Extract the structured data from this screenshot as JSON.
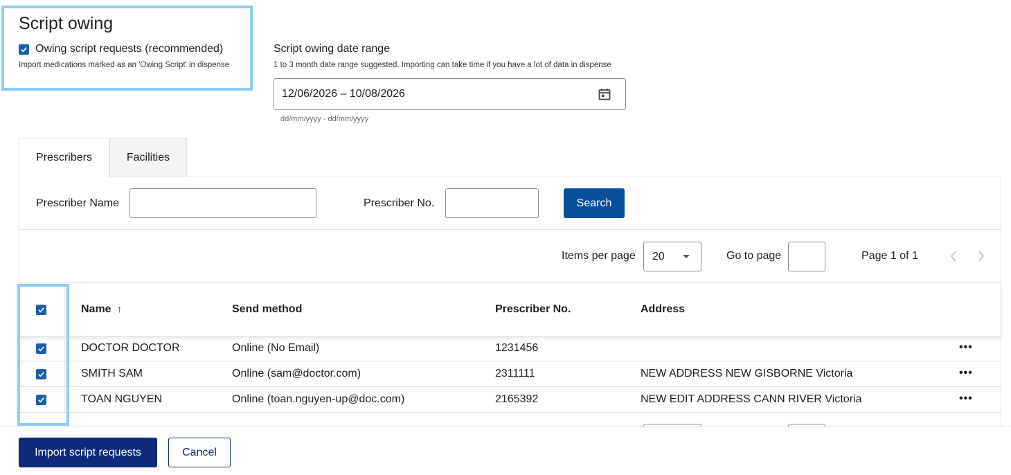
{
  "script_owing": {
    "title": "Script owing",
    "checkbox_label": "Owing script requests (recommended)",
    "checkbox_checked": true,
    "helper": "Import medications marked as an 'Owing Script' in dispense"
  },
  "date_range": {
    "label": "Script owing date range",
    "helper": "1 to 3 month date range suggested. Importing can take time if you have a lot of data in dispense",
    "value": "12/06/2026 – 10/08/2026",
    "format_hint": "dd/mm/yyyy - dd/mm/yyyy",
    "icon": "calendar-icon"
  },
  "tabs": [
    {
      "label": "Prescribers",
      "active": true
    },
    {
      "label": "Facilities",
      "active": false
    }
  ],
  "filters": {
    "name_label": "Prescriber Name",
    "name_value": "",
    "no_label": "Prescriber No.",
    "no_value": "",
    "search_label": "Search"
  },
  "pagination": {
    "items_per_page_label": "Items per page",
    "items_per_page_value": "20",
    "go_to_page_label": "Go to page",
    "go_to_page_value": "",
    "page_info": "Page 1 of 1"
  },
  "table": {
    "columns": {
      "name": "Name",
      "name_sort_icon": "↑",
      "send_method": "Send method",
      "prescriber_no": "Prescriber No.",
      "address": "Address"
    },
    "rows": [
      {
        "name": "DOCTOR DOCTOR",
        "send_method": "Online (No Email)",
        "prescriber_no": "1231456",
        "address": "",
        "checked": true
      },
      {
        "name": "SMITH SAM",
        "send_method": "Online (sam@doctor.com)",
        "prescriber_no": "2311111",
        "address": "NEW ADDRESS NEW GISBORNE Victoria",
        "checked": true
      },
      {
        "name": "TOAN NGUYEN",
        "send_method": "Online (toan.nguyen-up@doc.com)",
        "prescriber_no": "2165392",
        "address": "NEW EDIT ADDRESS CANN RIVER Victoria",
        "checked": true
      }
    ],
    "more_icon": "•••"
  },
  "actions": {
    "import_label": "Import script requests",
    "cancel_label": "Cancel"
  },
  "colors": {
    "accent": "#0a4f9b",
    "dark_button": "#0f2a7a",
    "highlight": "#8ecdf3",
    "checkbox": "#1b5fa8"
  }
}
